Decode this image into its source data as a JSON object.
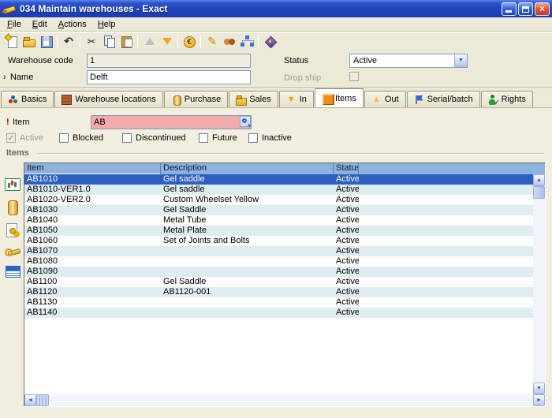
{
  "window": {
    "title": "034 Maintain warehouses - Exact",
    "controls": [
      "minimize",
      "maximize",
      "close"
    ]
  },
  "menu": {
    "items": [
      "File",
      "Edit",
      "Actions",
      "Help"
    ]
  },
  "toolbar": {
    "icons": [
      "new-icon",
      "open-icon",
      "save-icon",
      "|",
      "undo-icon",
      "|",
      "cut-icon",
      "copy-icon",
      "paste-icon",
      "|",
      "up-icon",
      "down-icon",
      "|",
      "euro-icon",
      "|",
      "pencil-icon",
      "handshake-icon",
      "orgchart-icon",
      "|",
      "diamond-icon"
    ]
  },
  "form": {
    "warehouse_code": {
      "label": "Warehouse code",
      "value": "1"
    },
    "name": {
      "label": "Name",
      "value": "Delft",
      "marker": "›"
    },
    "status": {
      "label": "Status",
      "value": "Active"
    },
    "drop_ship": {
      "label": "Drop ship",
      "checked": false
    }
  },
  "tabs": [
    {
      "label": "Basics",
      "icon": "basics",
      "active": false
    },
    {
      "label": "Warehouse locations",
      "icon": "locations",
      "active": false
    },
    {
      "label": "Purchase",
      "icon": "purchase",
      "active": false
    },
    {
      "label": "Sales",
      "icon": "sales",
      "active": false
    },
    {
      "label": "In",
      "icon": "in",
      "active": false
    },
    {
      "label": "Items",
      "icon": "items",
      "active": true
    },
    {
      "label": "Out",
      "icon": "out",
      "active": false
    },
    {
      "label": "Serial/batch",
      "icon": "serial",
      "active": false
    },
    {
      "label": "Rights",
      "icon": "rights",
      "active": false
    }
  ],
  "filter": {
    "item": {
      "label": "Item",
      "required_marker": "!",
      "value": "AB"
    },
    "checkboxes": [
      {
        "label": "Active",
        "checked": true,
        "disabled": true
      },
      {
        "label": "Blocked",
        "checked": false,
        "disabled": false
      },
      {
        "label": "Discontinued",
        "checked": false,
        "disabled": false
      },
      {
        "label": "Future",
        "checked": false,
        "disabled": false
      },
      {
        "label": "Inactive",
        "checked": false,
        "disabled": false
      }
    ]
  },
  "items_section": {
    "title": "Items"
  },
  "table": {
    "columns": [
      "Item",
      "Description",
      "Status"
    ],
    "rows": [
      {
        "item": "AB1010",
        "description": "Gel saddle",
        "status": "Active",
        "selected": true
      },
      {
        "item": "AB1010-VER1.0",
        "description": "Gel saddle",
        "status": "Active",
        "selected": false
      },
      {
        "item": "AB1020-VER2.0",
        "description": "Custom Wheelset Yellow",
        "status": "Active",
        "selected": false
      },
      {
        "item": "AB1030",
        "description": "Gel Saddle",
        "status": "Active",
        "selected": false
      },
      {
        "item": "AB1040",
        "description": "Metal Tube",
        "status": "Active",
        "selected": false
      },
      {
        "item": "AB1050",
        "description": "Metal Plate",
        "status": "Active",
        "selected": false
      },
      {
        "item": "AB1060",
        "description": "Set of Joints and Bolts",
        "status": "Active",
        "selected": false
      },
      {
        "item": "AB1070",
        "description": "",
        "status": "Active",
        "selected": false
      },
      {
        "item": "AB1080",
        "description": "",
        "status": "Active",
        "selected": false
      },
      {
        "item": "AB1090",
        "description": "",
        "status": "Active",
        "selected": false
      },
      {
        "item": "AB1100",
        "description": "Gel Saddle",
        "status": "Active",
        "selected": false
      },
      {
        "item": "AB1120",
        "description": "AB1120-001",
        "status": "Active",
        "selected": false
      },
      {
        "item": "AB1130",
        "description": "",
        "status": "Active",
        "selected": false
      },
      {
        "item": "AB1140",
        "description": "",
        "status": "Active",
        "selected": false
      }
    ]
  },
  "sidebar": {
    "icons": [
      "chart-card-icon",
      "stock-cylinder-icon",
      "document-gears-icon",
      "wrench-icon",
      "list-card-icon"
    ]
  },
  "colors": {
    "selection": "#2b5fc0",
    "grid_header": "#8db2dd",
    "alt_row": "#dfedf0",
    "required_field_pink": "#f2abab",
    "titlebar_blue": "#1f44bc"
  }
}
